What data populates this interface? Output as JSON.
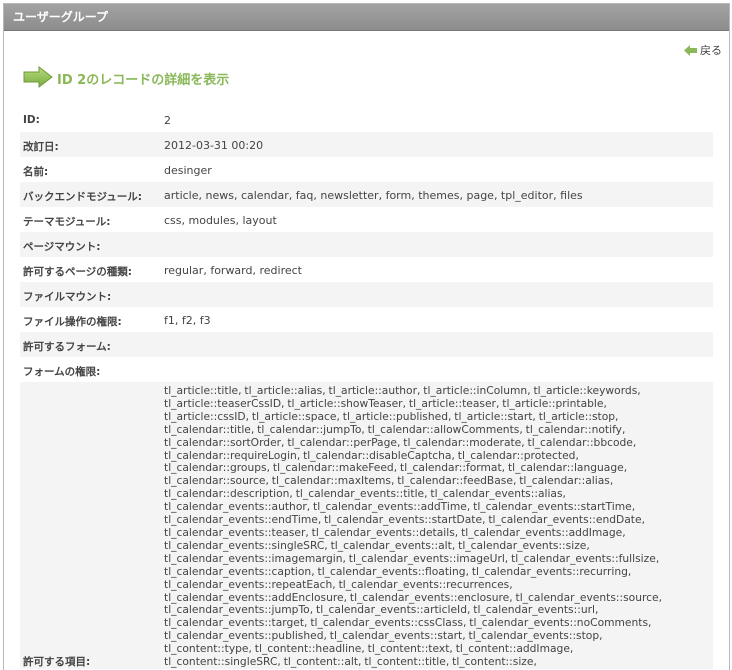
{
  "panel": {
    "title": "ユーザーグループ"
  },
  "back": {
    "label": "戻る"
  },
  "heading": {
    "text": "ID 2のレコードの詳細を表示"
  },
  "rows": [
    {
      "label": "ID:",
      "value": "2"
    },
    {
      "label": "改訂日:",
      "value": "2012-03-31 00:20"
    },
    {
      "label": "名前:",
      "value": "desinger"
    },
    {
      "label": "バックエンドモジュール:",
      "value": "article, news, calendar, faq, newsletter, form, themes, page, tpl_editor, files"
    },
    {
      "label": "テーマモジュール:",
      "value": "css, modules, layout"
    },
    {
      "label": "ページマウント:",
      "value": ""
    },
    {
      "label": "許可するページの種類:",
      "value": "regular, forward, redirect"
    },
    {
      "label": "ファイルマウント:",
      "value": ""
    },
    {
      "label": "ファイル操作の権限:",
      "value": "f1, f2, f3"
    },
    {
      "label": "許可するフォーム:",
      "value": ""
    },
    {
      "label": "フォームの権限:",
      "value": ""
    },
    {
      "label": "許可する項目:",
      "lines": [
        "tl_article::title, tl_article::alias, tl_article::author, tl_article::inColumn, tl_article::keywords,",
        "tl_article::teaserCssID, tl_article::showTeaser, tl_article::teaser, tl_article::printable,",
        "tl_article::cssID, tl_article::space, tl_article::published, tl_article::start, tl_article::stop,",
        "tl_calendar::title, tl_calendar::jumpTo, tl_calendar::allowComments, tl_calendar::notify,",
        "tl_calendar::sortOrder, tl_calendar::perPage, tl_calendar::moderate, tl_calendar::bbcode,",
        "tl_calendar::requireLogin, tl_calendar::disableCaptcha, tl_calendar::protected,",
        "tl_calendar::groups, tl_calendar::makeFeed, tl_calendar::format, tl_calendar::language,",
        "tl_calendar::source, tl_calendar::maxItems, tl_calendar::feedBase, tl_calendar::alias,",
        "tl_calendar::description, tl_calendar_events::title, tl_calendar_events::alias,",
        "tl_calendar_events::author, tl_calendar_events::addTime, tl_calendar_events::startTime,",
        "tl_calendar_events::endTime, tl_calendar_events::startDate, tl_calendar_events::endDate,",
        "tl_calendar_events::teaser, tl_calendar_events::details, tl_calendar_events::addImage,",
        "tl_calendar_events::singleSRC, tl_calendar_events::alt, tl_calendar_events::size,",
        "tl_calendar_events::imagemargin, tl_calendar_events::imageUrl, tl_calendar_events::fullsize,",
        "tl_calendar_events::caption, tl_calendar_events::floating, tl_calendar_events::recurring,",
        "tl_calendar_events::repeatEach, tl_calendar_events::recurrences,",
        "tl_calendar_events::addEnclosure, tl_calendar_events::enclosure, tl_calendar_events::source,",
        "tl_calendar_events::jumpTo, tl_calendar_events::articleId, tl_calendar_events::url,",
        "tl_calendar_events::target, tl_calendar_events::cssClass, tl_calendar_events::noComments,",
        "tl_calendar_events::published, tl_calendar_events::start, tl_calendar_events::stop,",
        "tl_content::type, tl_content::headline, tl_content::text, tl_content::addImage,",
        "tl_content::singleSRC, tl_content::alt, tl_content::title, tl_content::size,"
      ]
    }
  ],
  "colors": {
    "accent": "#8ab858",
    "header": "#999999",
    "row_alt": "#f4f4f4"
  }
}
